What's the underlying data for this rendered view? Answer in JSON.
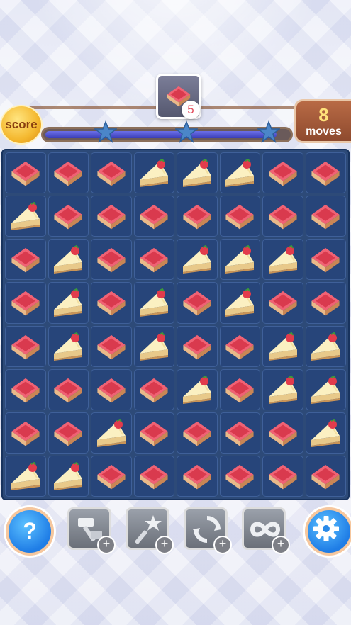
{
  "goal": {
    "count": "5",
    "piece": "red-square-cake"
  },
  "score": {
    "label": "score",
    "progress_fraction": 0.95,
    "stars": 3
  },
  "moves": {
    "value": "8",
    "label": "moves"
  },
  "board": {
    "rows": [
      [
        "square",
        "square",
        "square",
        "slice",
        "slice",
        "slice",
        "square",
        "square"
      ],
      [
        "slice",
        "square",
        "square",
        "square",
        "square",
        "square",
        "square",
        "square"
      ],
      [
        "square",
        "slice",
        "square",
        "square",
        "slice",
        "slice",
        "slice",
        "square"
      ],
      [
        "square",
        "slice",
        "square",
        "slice",
        "square",
        "slice",
        "square",
        "square"
      ],
      [
        "square",
        "slice",
        "square",
        "slice",
        "square",
        "square",
        "slice",
        "slice"
      ],
      [
        "square",
        "square",
        "square",
        "square",
        "slice",
        "square",
        "slice",
        "slice"
      ],
      [
        "square",
        "square",
        "slice",
        "square",
        "square",
        "square",
        "square",
        "slice"
      ],
      [
        "slice",
        "slice",
        "square",
        "square",
        "square",
        "square",
        "square",
        "square"
      ]
    ]
  },
  "toolbar": {
    "help_glyph": "?",
    "tools": [
      {
        "name": "hammer-icon"
      },
      {
        "name": "magic-wand-icon"
      },
      {
        "name": "shuffle-icon"
      },
      {
        "name": "infinity-icon"
      }
    ],
    "plus_glyph": "+"
  },
  "colors": {
    "square": "#e8465a",
    "slice": "#f6e7a6",
    "board": "#2d4a78"
  }
}
